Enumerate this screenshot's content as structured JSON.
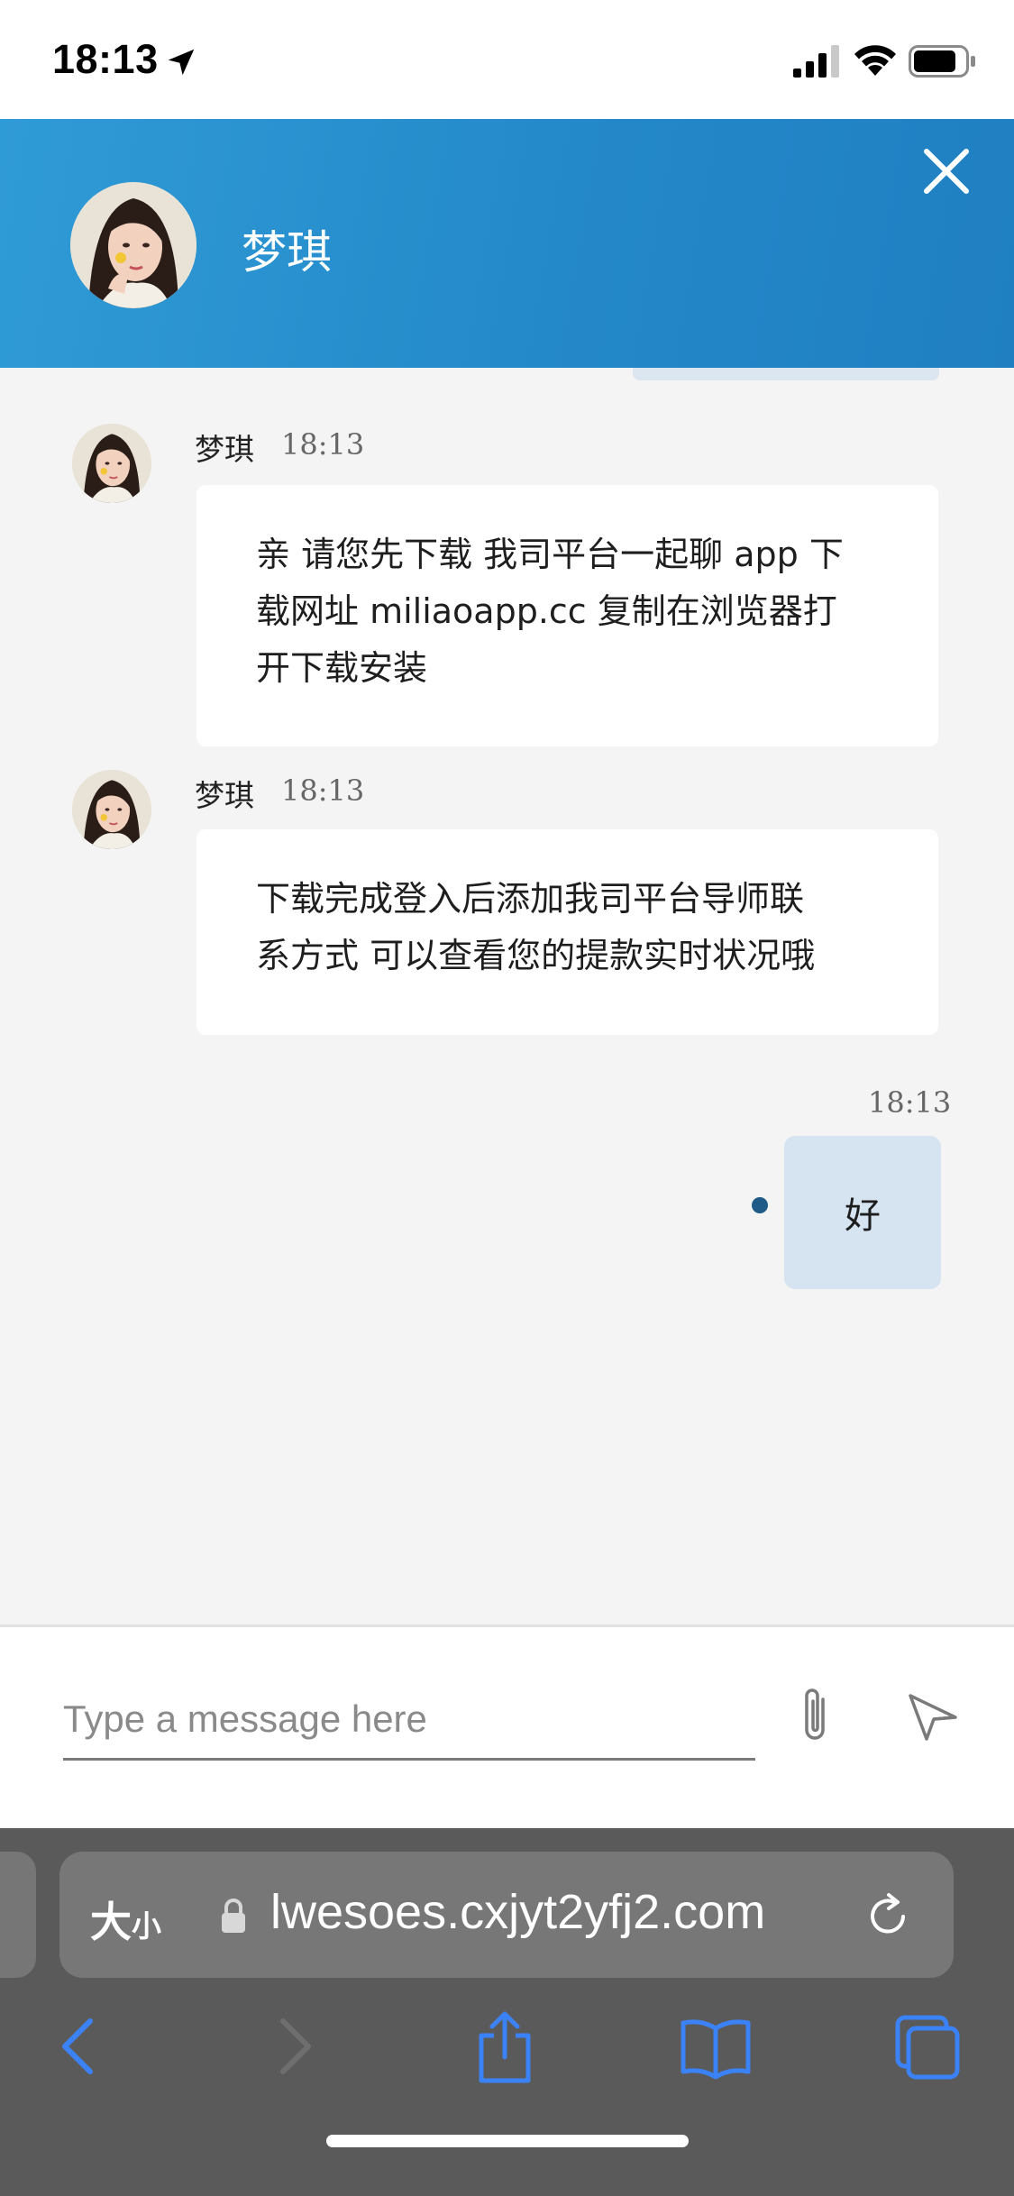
{
  "status_bar": {
    "time": "18:13"
  },
  "chat_header": {
    "agent_name": "梦琪",
    "avatar": "woman-portrait-avatar",
    "close_icon": "close-icon",
    "header_color": "#2489c9"
  },
  "messages": [
    {
      "direction": "incoming",
      "sender": "梦琪",
      "time": "18:13",
      "lines": [
        "亲 请您先下载 我司平台一起聊 app 下",
        "载网址 miliaoapp.cc 复制在浏览器打",
        "开下载安装"
      ]
    },
    {
      "direction": "incoming",
      "sender": "梦琪",
      "time": "18:13",
      "lines": [
        "下载完成登入后添加我司平台导师联",
        "系方式 可以查看您的提款实时状况哦"
      ]
    },
    {
      "direction": "outgoing",
      "time": "18:13",
      "text": "好",
      "bubble_color": "#d6e4f1",
      "delivered_dot_color": "#1f5b86"
    }
  ],
  "composer": {
    "placeholder": "Type a message here",
    "value": "",
    "attach_icon": "paperclip-icon",
    "send_icon": "send-icon"
  },
  "safari": {
    "text_size_big": "大",
    "text_size_small": "小",
    "url": "lwesoes.cxjyt2yfj2.com",
    "icons": [
      "lock-icon",
      "reload-icon",
      "back-icon",
      "forward-icon",
      "share-icon",
      "bookmarks-icon",
      "tabs-icon"
    ],
    "accent_color": "#3b82f6"
  }
}
